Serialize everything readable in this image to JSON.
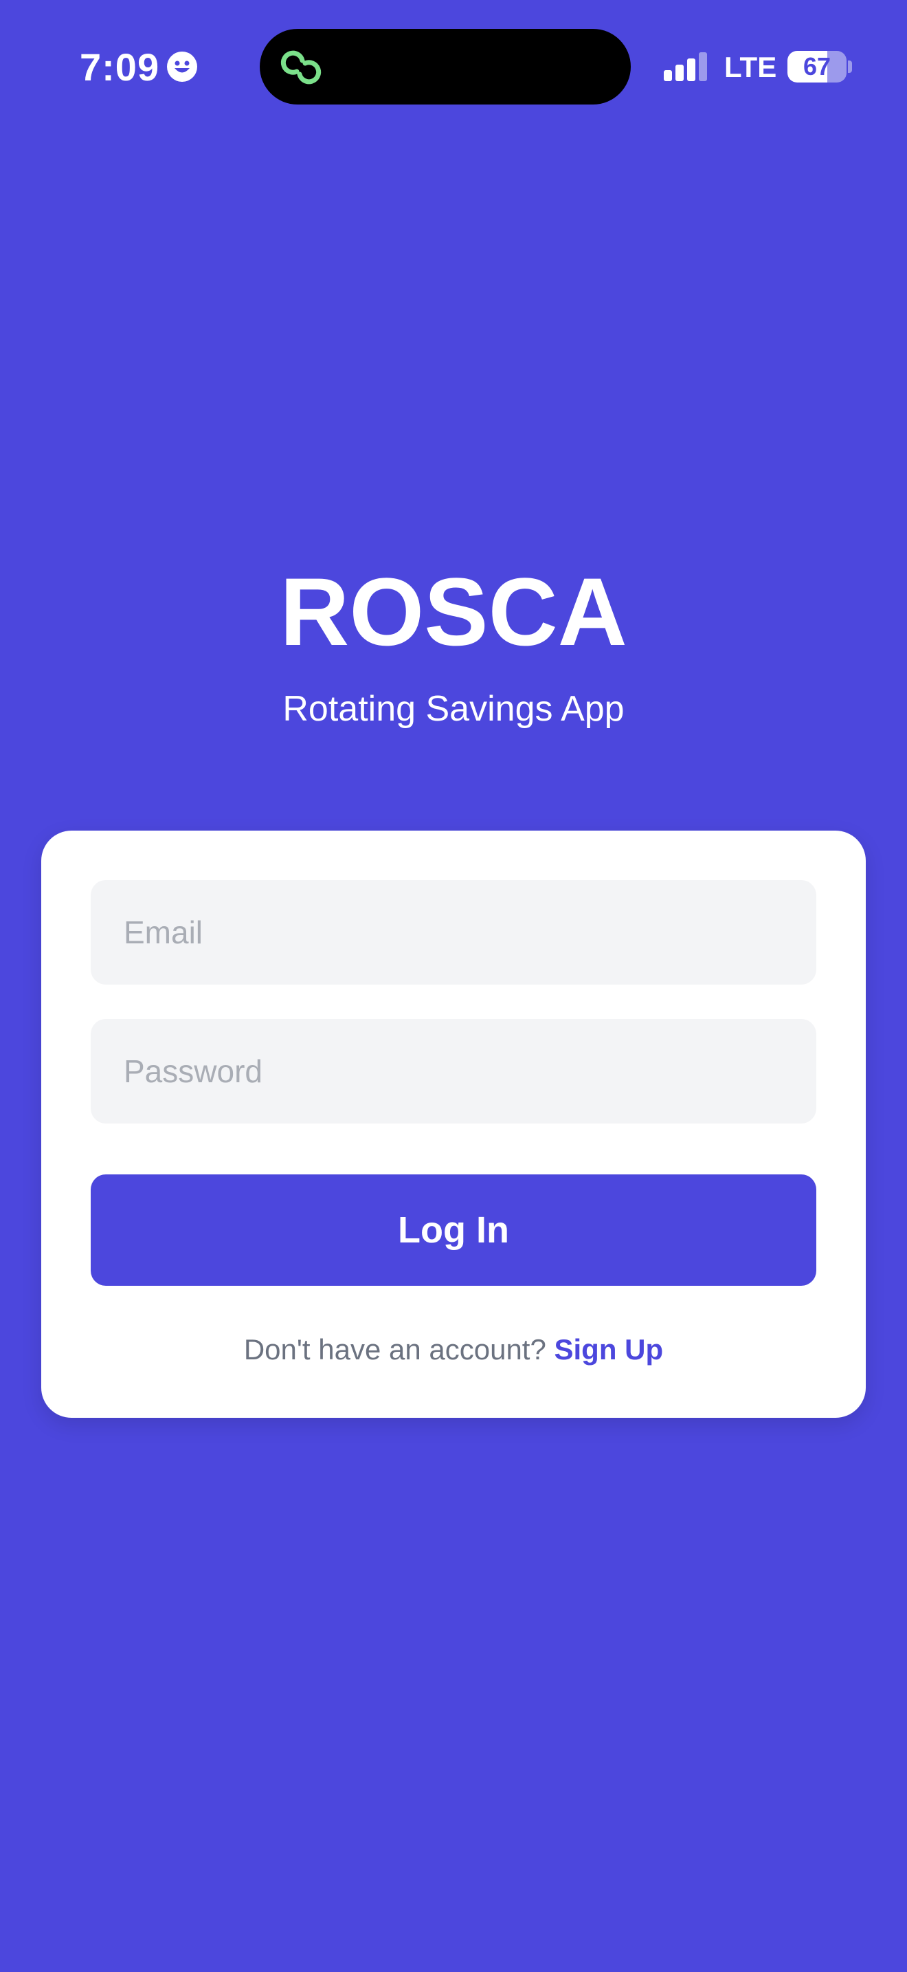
{
  "status_bar": {
    "time": "7:09",
    "network": "LTE",
    "battery_level": "67",
    "battery_fraction": 0.67,
    "signal_bars_active": 3,
    "signal_bars_total": 4,
    "icons": {
      "emoji": "smiley-face-icon",
      "island": "link-rings-icon",
      "signal": "cellular-signal-icon",
      "battery": "battery-icon"
    }
  },
  "header": {
    "title": "ROSCA",
    "subtitle": "Rotating Savings App"
  },
  "login_form": {
    "email_placeholder": "Email",
    "email_value": "",
    "password_placeholder": "Password",
    "password_value": "",
    "login_label": "Log In",
    "signup_prompt": "Don't have an account?",
    "signup_link": "Sign Up"
  },
  "colors": {
    "background": "#4c47dd",
    "accent": "#4c47dd",
    "card": "#ffffff",
    "field_background": "#f3f4f6",
    "island_icon": "#7be08a"
  }
}
